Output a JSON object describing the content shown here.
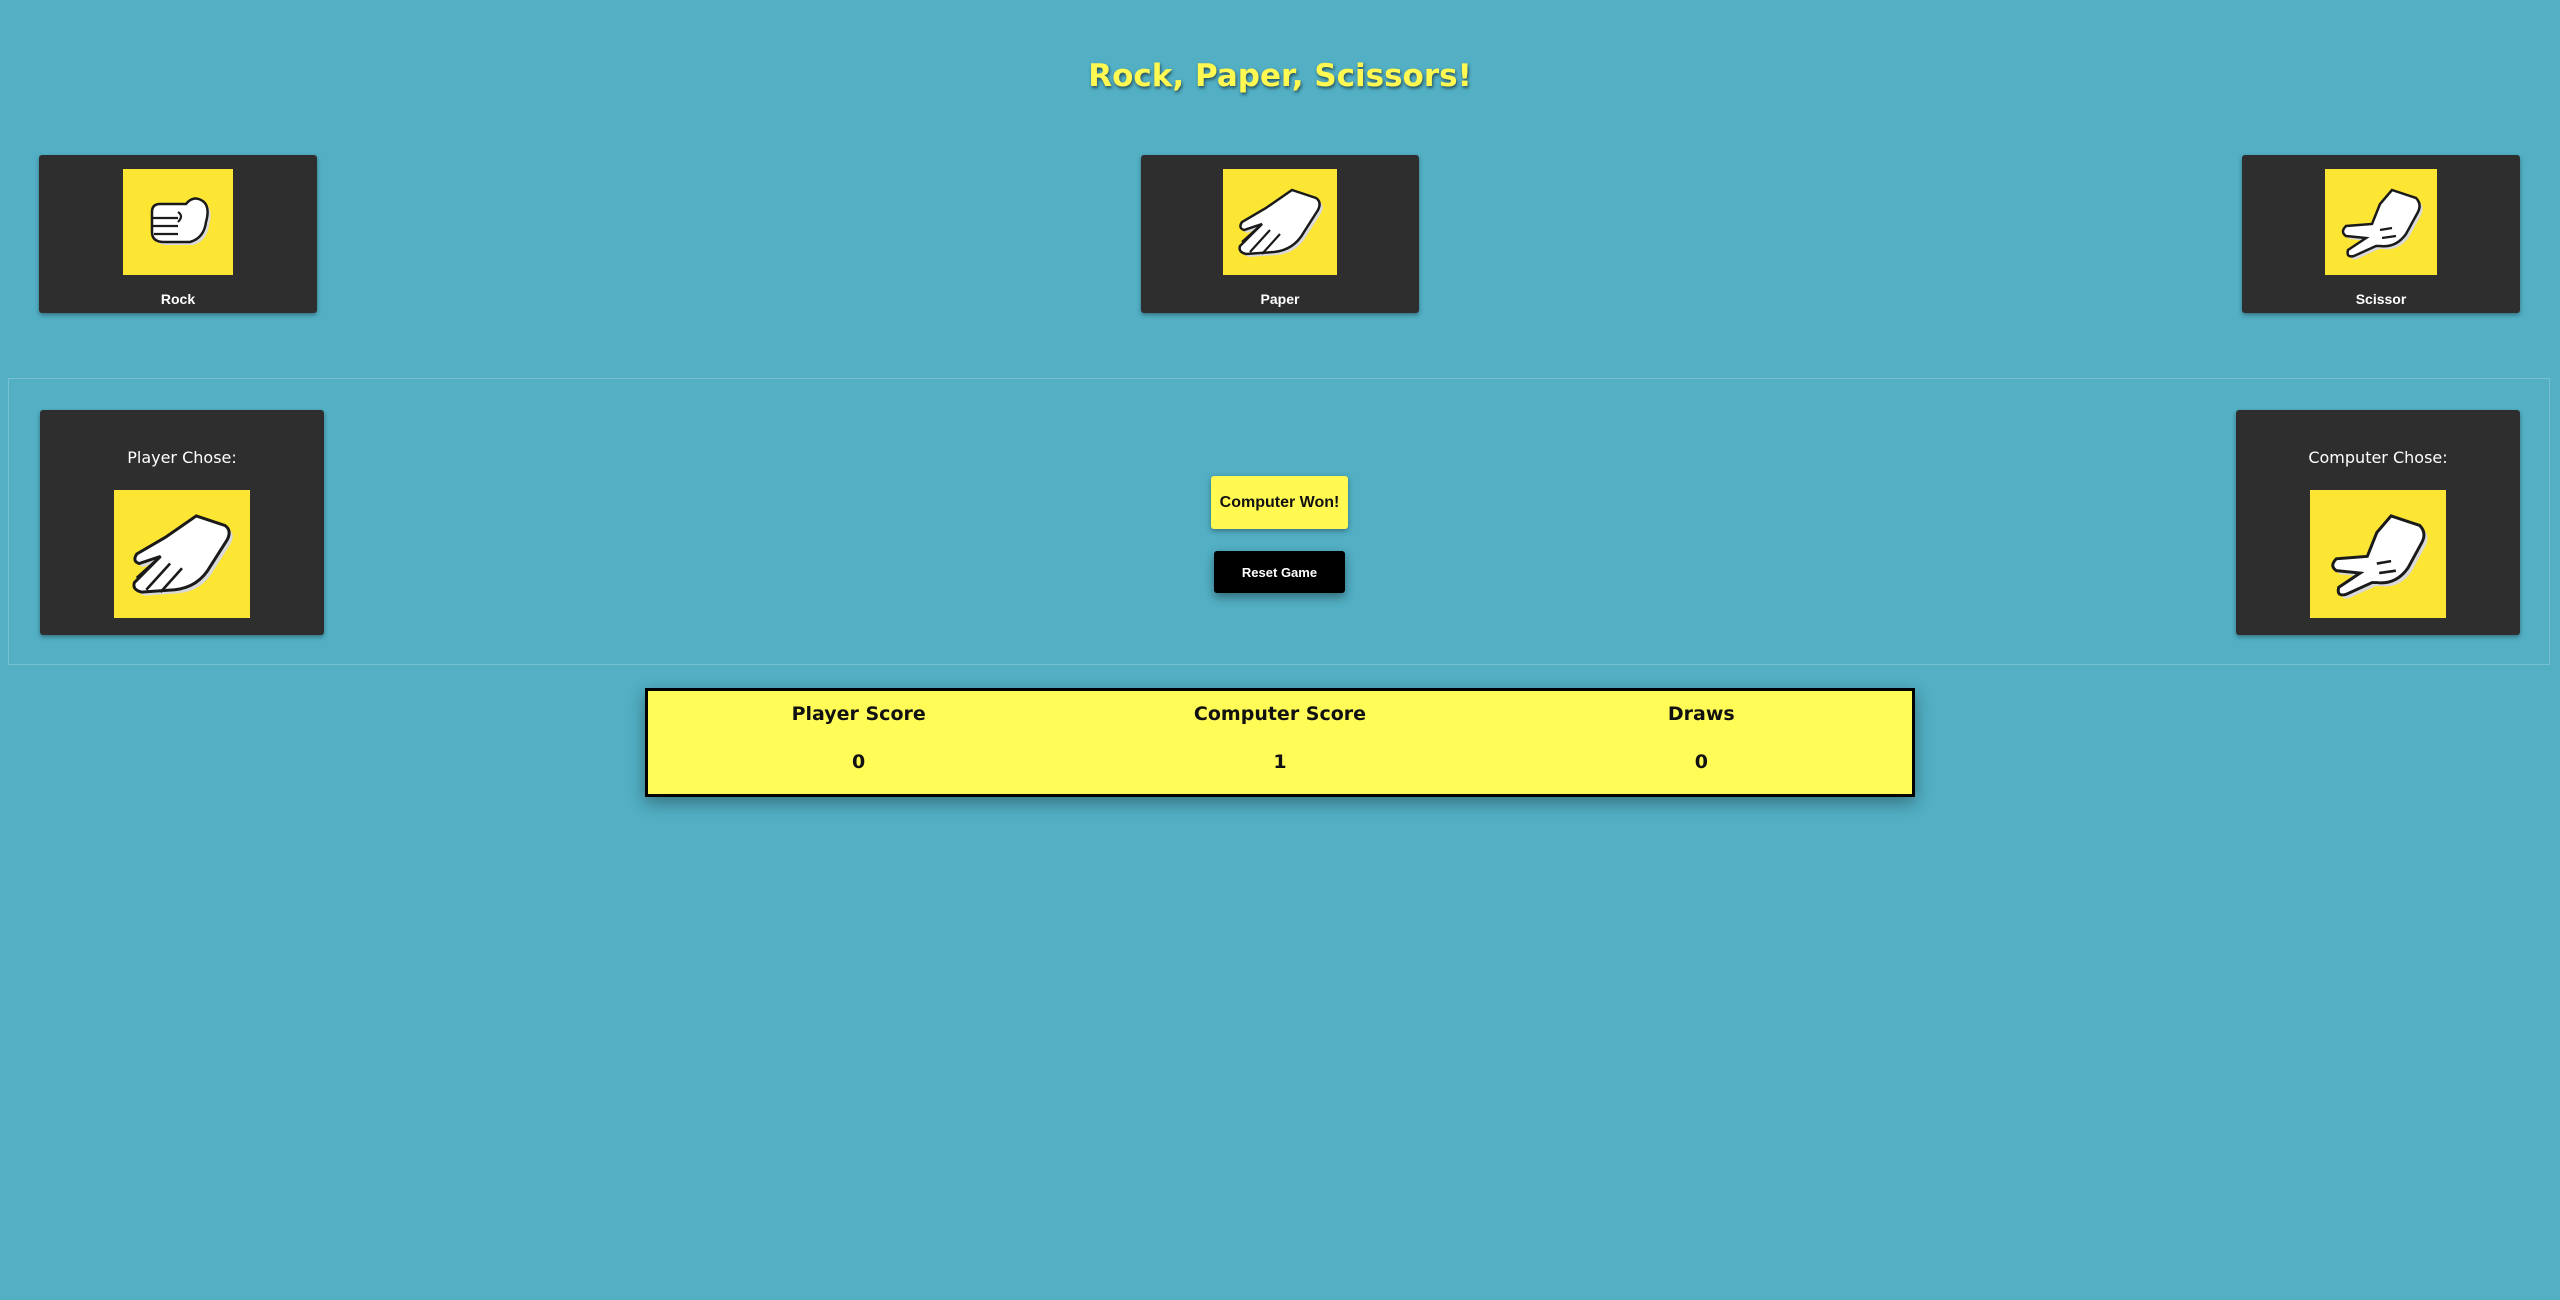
{
  "title": "Rock, Paper, Scissors!",
  "choices": [
    {
      "label": "Rock",
      "icon": "rock-hand-icon"
    },
    {
      "label": "Paper",
      "icon": "paper-hand-icon"
    },
    {
      "label": "Scissor",
      "icon": "scissor-hand-icon"
    }
  ],
  "player": {
    "caption": "Player Chose:",
    "icon": "paper-hand-icon"
  },
  "computer": {
    "caption": "Computer Chose:",
    "icon": "scissor-hand-icon"
  },
  "status": "Computer Won!",
  "reset_label": "Reset Game",
  "scoreboard": {
    "columns": [
      {
        "label": "Player Score",
        "value": "0"
      },
      {
        "label": "Computer Score",
        "value": "1"
      },
      {
        "label": "Draws",
        "value": "0"
      }
    ]
  },
  "colors": {
    "background": "#52afc4",
    "accent_yellow": "#fff952",
    "card_dark": "#2e2e2e",
    "button_black": "#000000"
  }
}
